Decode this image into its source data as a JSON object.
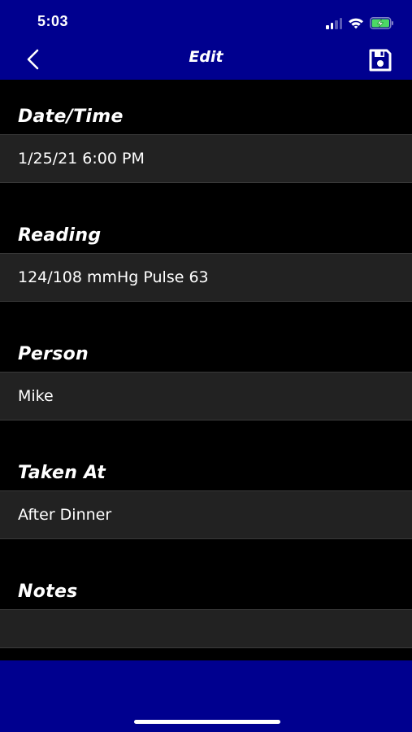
{
  "status_bar": {
    "time": "5:03",
    "icons": [
      "cellular-signal-icon",
      "wifi-icon",
      "battery-charging-icon"
    ]
  },
  "nav": {
    "title": "Edit",
    "back_icon": "chevron-left-icon",
    "save_icon": "floppy-disk-icon"
  },
  "form": {
    "fields": [
      {
        "label": "Date/Time",
        "value": "1/25/21  6:00 PM"
      },
      {
        "label": "Reading",
        "value": "124/108 mmHg Pulse 63"
      },
      {
        "label": "Person",
        "value": "Mike"
      },
      {
        "label": "Taken At",
        "value": "After Dinner"
      },
      {
        "label": "Notes",
        "value": ""
      }
    ]
  },
  "colors": {
    "bar_blue": "#00008f",
    "background": "#000000",
    "field_background": "#222222",
    "text": "#ffffff"
  }
}
